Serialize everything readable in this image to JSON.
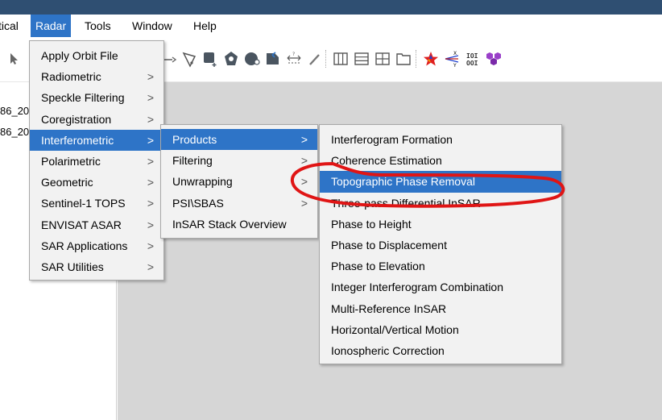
{
  "menubar": {
    "partial": "tical",
    "items": [
      "Radar",
      "Tools",
      "Window",
      "Help"
    ]
  },
  "left_panel": {
    "rows": [
      "86_20",
      "86_20"
    ]
  },
  "radar_menu": {
    "items": [
      {
        "label": "Apply Orbit File",
        "arrow": ""
      },
      {
        "label": "Radiometric",
        "arrow": ">"
      },
      {
        "label": "Speckle Filtering",
        "arrow": ">"
      },
      {
        "label": "Coregistration",
        "arrow": ">"
      },
      {
        "label": "Interferometric",
        "arrow": ">"
      },
      {
        "label": "Polarimetric",
        "arrow": ">"
      },
      {
        "label": "Geometric",
        "arrow": ">"
      },
      {
        "label": "Sentinel-1 TOPS",
        "arrow": ">"
      },
      {
        "label": "ENVISAT ASAR",
        "arrow": ">"
      },
      {
        "label": "SAR Applications",
        "arrow": ">"
      },
      {
        "label": "SAR Utilities",
        "arrow": ">"
      }
    ]
  },
  "interferometric_menu": {
    "items": [
      {
        "label": "Products",
        "arrow": ">"
      },
      {
        "label": "Filtering",
        "arrow": ">"
      },
      {
        "label": "Unwrapping",
        "arrow": ">"
      },
      {
        "label": "PSI\\SBAS",
        "arrow": ">"
      },
      {
        "label": "InSAR Stack Overview",
        "arrow": ""
      }
    ]
  },
  "products_menu": {
    "items": [
      {
        "label": "Interferogram Formation"
      },
      {
        "label": "Coherence Estimation"
      },
      {
        "label": "Topographic Phase Removal"
      },
      {
        "label": "Three-pass Differential InSAR"
      },
      {
        "label": "Phase to Height"
      },
      {
        "label": "Phase to Displacement"
      },
      {
        "label": "Phase to Elevation"
      },
      {
        "label": "Integer Interferogram Combination"
      },
      {
        "label": "Multi-Reference InSAR"
      },
      {
        "label": "Horizontal/Vertical Motion"
      },
      {
        "label": "Ionospheric Correction"
      }
    ]
  },
  "toolbar": {
    "icons": [
      "cursor-icon",
      "draw-line-icon",
      "draw-polygon-icon",
      "add-rectangle-icon",
      "pan-icon",
      "zoom-icon",
      "import-vector-icon",
      "range-finder-icon",
      "magic-wand-icon",
      "tile-vertical-icon",
      "tile-horizontal-icon",
      "tile-grid-icon",
      "tile-window-icon",
      "star-plugin-icon",
      "xy-axes-icon",
      "binary-icon",
      "purple-cluster-icon"
    ],
    "binary_text": "IOI OOI",
    "xy_text": "X Y"
  },
  "colors": {
    "title_bar": "#2f4f72",
    "selection": "#2e74c7",
    "menu_bg": "#f2f2f2",
    "canvas": "#d6d6d6",
    "annotation": "#e01515"
  }
}
